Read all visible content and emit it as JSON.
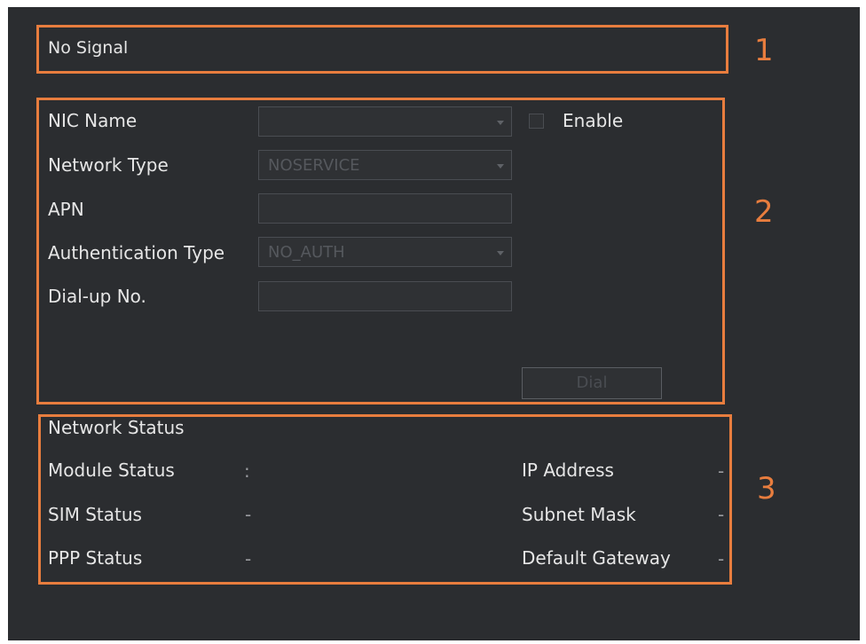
{
  "status_bar": {
    "text": "No Signal"
  },
  "markers": {
    "m1": "1",
    "m2": "2",
    "m3": "3"
  },
  "config": {
    "nic_name": {
      "label": "NIC Name",
      "value": ""
    },
    "enable": {
      "label": "Enable",
      "checked": false
    },
    "network_type": {
      "label": "Network Type",
      "value": "NOSERVICE"
    },
    "apn": {
      "label": "APN",
      "value": ""
    },
    "auth_type": {
      "label": "Authentication Type",
      "value": "NO_AUTH"
    },
    "dialup": {
      "label": "Dial-up No.",
      "value": ""
    },
    "dial_button": "Dial"
  },
  "network_status": {
    "title": "Network Status",
    "module_status": {
      "label": "Module Status",
      "value": ":"
    },
    "sim_status": {
      "label": "SIM Status",
      "value": "-"
    },
    "ppp_status": {
      "label": "PPP Status",
      "value": "-"
    },
    "ip_address": {
      "label": "IP Address",
      "value": "-"
    },
    "subnet_mask": {
      "label": "Subnet Mask",
      "value": "-"
    },
    "default_gateway": {
      "label": "Default Gateway",
      "value": "-"
    }
  },
  "colors": {
    "panel": "#2b2d30",
    "highlight": "#e87d3e",
    "text": "#e6e6e6"
  }
}
